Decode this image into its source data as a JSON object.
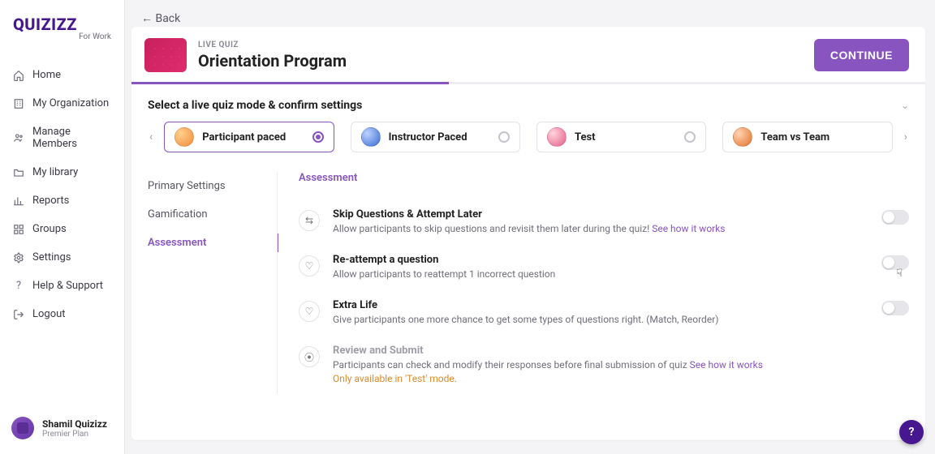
{
  "brand": {
    "name": "QUIZIZZ",
    "sub": "For Work"
  },
  "sidebar": {
    "items": [
      {
        "label": "Home"
      },
      {
        "label": "My Organization"
      },
      {
        "label": "Manage Members"
      },
      {
        "label": "My library"
      },
      {
        "label": "Reports"
      },
      {
        "label": "Groups"
      },
      {
        "label": "Settings"
      },
      {
        "label": "Help & Support"
      },
      {
        "label": "Logout"
      }
    ]
  },
  "user": {
    "name": "Shamil Quizizz",
    "plan": "Premier Plan"
  },
  "back_label": "← Back",
  "header": {
    "kicker": "LIVE QUIZ",
    "title": "Orientation Program",
    "continue": "CONTINUE",
    "progress_pct": 40
  },
  "modes": {
    "title": "Select a live quiz mode & confirm settings",
    "items": [
      {
        "label": "Participant paced",
        "selected": true
      },
      {
        "label": "Instructor Paced",
        "selected": false
      },
      {
        "label": "Test",
        "selected": false
      },
      {
        "label": "Team vs Team",
        "selected": false
      }
    ]
  },
  "settings_tabs": {
    "items": [
      {
        "label": "Primary Settings"
      },
      {
        "label": "Gamification"
      },
      {
        "label": "Assessment"
      }
    ],
    "active": "Assessment"
  },
  "assessment": {
    "heading": "Assessment",
    "rows": [
      {
        "title": "Skip Questions & Attempt Later",
        "desc": "Allow participants to skip questions and revisit them later during the quiz! ",
        "link": "See how it works"
      },
      {
        "title": "Re-attempt a question",
        "desc": "Allow participants to reattempt 1 incorrect question"
      },
      {
        "title": "Extra Life",
        "desc": "Give participants one more chance to get some types of questions right. (Match, Reorder)"
      },
      {
        "title": "Review and Submit",
        "desc": "Participants can check and modify their responses before final submission of quiz ",
        "link": "See how it works",
        "warn": "Only available in 'Test' mode.",
        "disabled": true
      }
    ]
  },
  "help_symbol": "?"
}
